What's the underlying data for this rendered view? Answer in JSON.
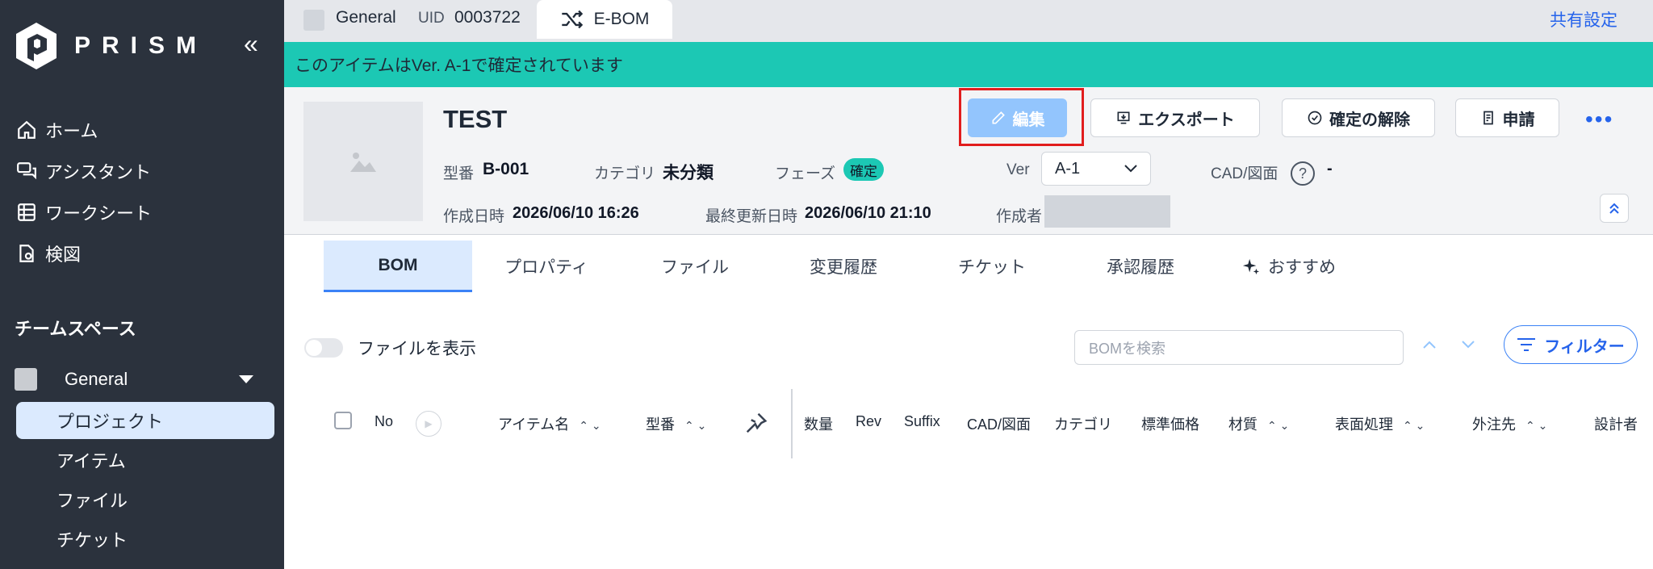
{
  "sidebar": {
    "logo_text": "PRISM",
    "collapse": "«",
    "nav": [
      "ホーム",
      "アシスタント",
      "ワークシート",
      "検図"
    ],
    "section": "チームスペース",
    "workspace": "General",
    "items": [
      "プロジェクト",
      "アイテム",
      "ファイル",
      "チケット"
    ]
  },
  "topbar": {
    "workspace": "General",
    "uid_label": "UID",
    "uid_value": "0003722",
    "tab_label": "E-BOM",
    "share_label": "共有設定"
  },
  "banner": "このアイテムはVer. A-1で確定されています",
  "item": {
    "title": "TEST",
    "part_label": "型番",
    "part_value": "B-001",
    "category_label": "カテゴリ",
    "category_value": "未分類",
    "phase_label": "フェーズ",
    "phase_value": "確定",
    "ver_label": "Ver",
    "ver_value": "A-1",
    "cad_label": "CAD/図面",
    "cad_value": "-",
    "created_label": "作成日時",
    "created_value": "2026/06/10 16:26",
    "updated_label": "最終更新日時",
    "updated_value": "2026/06/10 21:10",
    "author_label": "作成者"
  },
  "actions": {
    "edit": "編集",
    "export": "エクスポート",
    "unconfirm": "確定の解除",
    "request": "申請",
    "more": "•••"
  },
  "tabs": [
    "BOM",
    "プロパティ",
    "ファイル",
    "変更履歴",
    "チケット",
    "承認履歴",
    "おすすめ"
  ],
  "bom": {
    "toggle_label": "ファイルを表示",
    "search_placeholder": "BOMを検索",
    "filter_label": "フィルター",
    "columns": [
      "No",
      "アイテム名",
      "型番",
      "数量",
      "Rev",
      "Suffix",
      "CAD/図面",
      "カテゴリ",
      "標準価格",
      "材質",
      "表面処理",
      "外注先",
      "設計者"
    ]
  },
  "colors": {
    "sidebar": "#2b323d",
    "banner": "#1cc8b4",
    "accent": "#2563eb",
    "highlight": "#e11d1d"
  }
}
